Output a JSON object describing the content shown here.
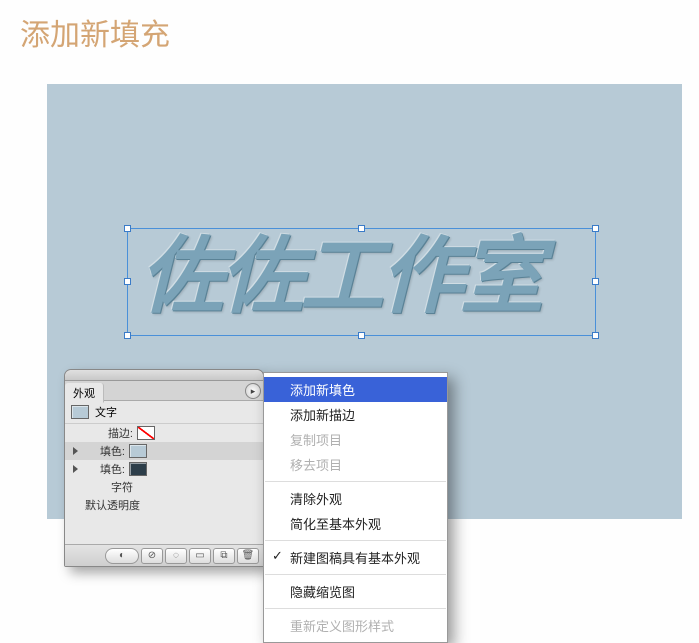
{
  "page_title": "添加新填充",
  "artwork_text": "佐佐工作室",
  "panel": {
    "tab": "外观",
    "type_label": "文字",
    "rows": {
      "stroke": "描边:",
      "fill1": "填色:",
      "fill2": "填色:",
      "chars": "字符",
      "default_opacity": "默认透明度"
    }
  },
  "menu": {
    "add_fill": "添加新填色",
    "add_stroke": "添加新描边",
    "duplicate": "复制项目",
    "remove": "移去项目",
    "clear": "清除外观",
    "reduce": "简化至基本外观",
    "new_art_basic": "新建图稿具有基本外观",
    "hide_thumb": "隐藏缩览图",
    "redefine": "重新定义图形样式"
  }
}
